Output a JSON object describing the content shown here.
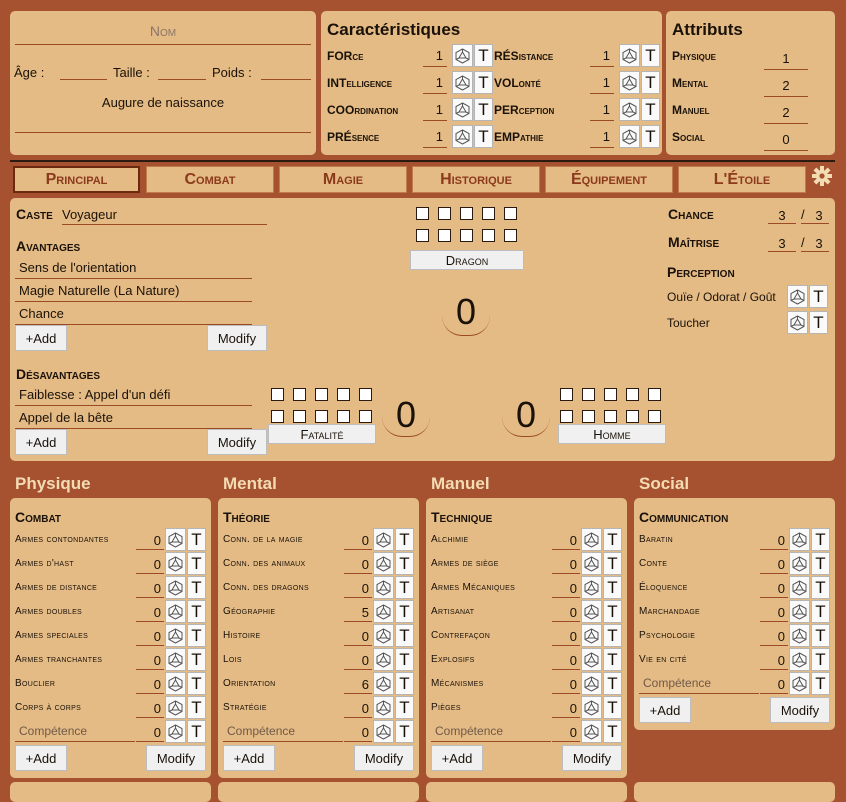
{
  "identity": {
    "name_placeholder": "Nom",
    "age": "Âge :",
    "taille": "Taille :",
    "poids": "Poids :",
    "augure": "Augure de naissance"
  },
  "caracteristiques": {
    "title": "Caractéristiques",
    "left": [
      {
        "pre": "FOR",
        "rest": "ce",
        "value": "1"
      },
      {
        "pre": "INT",
        "rest": "elligence",
        "value": "1"
      },
      {
        "pre": "COO",
        "rest": "rdination",
        "value": "1"
      },
      {
        "pre": "PRÉ",
        "rest": "sence",
        "value": "1"
      }
    ],
    "right": [
      {
        "pre": "RÉS",
        "rest": "istance",
        "value": "1"
      },
      {
        "pre": "VOL",
        "rest": "onté",
        "value": "1"
      },
      {
        "pre": "PER",
        "rest": "ception",
        "value": "1"
      },
      {
        "pre": "EMP",
        "rest": "athie",
        "value": "1"
      }
    ]
  },
  "attributs": {
    "title": "Attributs",
    "items": [
      {
        "label": "Physique",
        "value": "1"
      },
      {
        "label": "Mental",
        "value": "2"
      },
      {
        "label": "Manuel",
        "value": "2"
      },
      {
        "label": "Social",
        "value": "0"
      }
    ]
  },
  "tabs": [
    "Principal",
    "Combat",
    "Magie",
    "Historique",
    "Équipement",
    "L'Étoile"
  ],
  "main": {
    "caste_label": "Caste",
    "caste_value": "Voyageur",
    "avantages_label": "Avantages",
    "avantages": [
      "Sens de l'orientation",
      "Magie Naturelle (La Nature)",
      "Chance"
    ],
    "desavantages_label": "Désavantages",
    "desavantages": [
      "Faiblesse : Appel d'un défi",
      "Appel de la bête"
    ],
    "add": "+Add",
    "modify": "Modify",
    "dragon": "Dragon",
    "dragon_value": "0",
    "fatalite": "Fatalité",
    "fatalite_value": "0",
    "homme": "Homme",
    "homme_value": "0",
    "chance_label": "Chance",
    "chance": "3",
    "chance_max": "3",
    "maitrise_label": "Maîtrise",
    "maitrise": "3",
    "maitrise_max": "3",
    "perception_label": "Perception",
    "perception_items": [
      "Ouïe / Odorat / Goût",
      "Toucher"
    ],
    "slash": "/"
  },
  "sections": [
    {
      "title": "Physique",
      "group": "Combat",
      "skills": [
        {
          "n": "Armes contondantes",
          "v": "0"
        },
        {
          "n": "Armes d'hast",
          "v": "0"
        },
        {
          "n": "Armes de distance",
          "v": "0"
        },
        {
          "n": "Armes doubles",
          "v": "0"
        },
        {
          "n": "Armes speciales",
          "v": "0"
        },
        {
          "n": "Armes tranchantes",
          "v": "0"
        },
        {
          "n": "Bouclier",
          "v": "0"
        },
        {
          "n": "Corps à corps",
          "v": "0"
        }
      ],
      "comp": "Compétence",
      "comp_v": "0"
    },
    {
      "title": "Mental",
      "group": "Théorie",
      "skills": [
        {
          "n": "Conn. de la magie",
          "v": "0"
        },
        {
          "n": "Conn. des animaux",
          "v": "0"
        },
        {
          "n": "Conn. des dragons",
          "v": "0"
        },
        {
          "n": "Géographie",
          "v": "5"
        },
        {
          "n": "Histoire",
          "v": "0"
        },
        {
          "n": "Lois",
          "v": "0"
        },
        {
          "n": "Orientation",
          "v": "6"
        },
        {
          "n": "Stratégie",
          "v": "0"
        }
      ],
      "comp": "Compétence",
      "comp_v": "0"
    },
    {
      "title": "Manuel",
      "group": "Technique",
      "skills": [
        {
          "n": "Alchimie",
          "v": "0"
        },
        {
          "n": "Armes de siège",
          "v": "0"
        },
        {
          "n": "Armes Mécaniques",
          "v": "0"
        },
        {
          "n": "Artisanat",
          "v": "0"
        },
        {
          "n": "Contrefaçon",
          "v": "0"
        },
        {
          "n": "Explosifs",
          "v": "0"
        },
        {
          "n": "Mécanismes",
          "v": "0"
        },
        {
          "n": "Pièges",
          "v": "0"
        }
      ],
      "comp": "Compétence",
      "comp_v": "0"
    },
    {
      "title": "Social",
      "group": "Communication",
      "skills": [
        {
          "n": "Baratin",
          "v": "0"
        },
        {
          "n": "Conte",
          "v": "0"
        },
        {
          "n": "Éloquence",
          "v": "0"
        },
        {
          "n": "Marchandage",
          "v": "0"
        },
        {
          "n": "Psychologie",
          "v": "0"
        },
        {
          "n": "Vie en cité",
          "v": "0"
        }
      ],
      "comp": "Compétence",
      "comp_v": "0"
    }
  ],
  "t": "T",
  "icons": {
    "dice": "d20-dice-icon",
    "gear": "gear-icon"
  }
}
